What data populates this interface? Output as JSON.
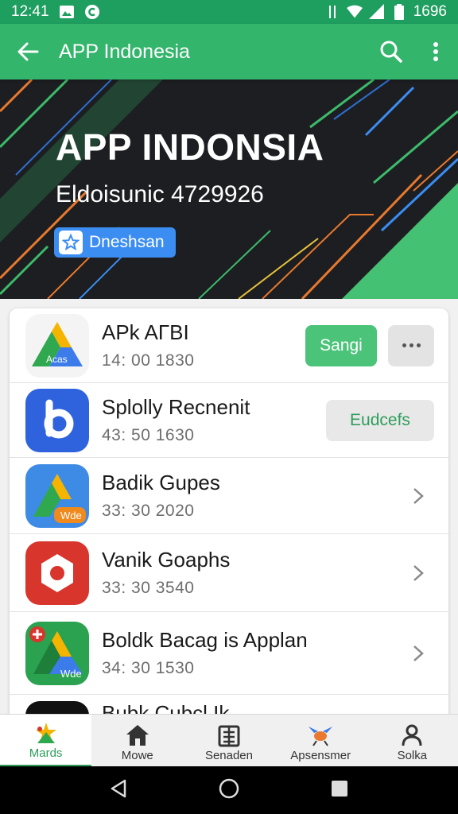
{
  "status_bar": {
    "time": "12:41",
    "battery_text": "1696"
  },
  "app_bar": {
    "title": "APP Indonesia"
  },
  "hero": {
    "title": "APP INDONSIA",
    "subtitle": "Eldoisunic 4729926",
    "badge_label": "Dneshsan"
  },
  "apps": [
    {
      "name": "APk AΓBI",
      "meta": "14: 00 1830",
      "primary_label": "Sangi",
      "icon_tag": "Acas"
    },
    {
      "name": "Splolly Recnenit",
      "meta": "43: 50 1630",
      "secondary_label": "Eudcefs"
    },
    {
      "name": "Badik Gupes",
      "meta": "33: 30 2020",
      "icon_tag": "Wde"
    },
    {
      "name": "Vanik Goaphs",
      "meta": "33: 30 3540"
    },
    {
      "name": "Boldk Bacag is Applan",
      "meta": "34: 30 1530",
      "icon_tag": "Wde"
    },
    {
      "name": "Bubk Cubcl Ik"
    }
  ],
  "bottom_nav": [
    {
      "label": "Mards",
      "icon": "leaf-star-icon"
    },
    {
      "label": "Mowe",
      "icon": "home-icon"
    },
    {
      "label": "Senaden",
      "icon": "building-icon"
    },
    {
      "label": "Apsensmer",
      "icon": "bird-icon"
    },
    {
      "label": "Solka",
      "icon": "person-icon"
    }
  ],
  "colors": {
    "accent": "#33b56c",
    "status_bar": "#1e9e5f",
    "badge": "#3b8df2"
  }
}
